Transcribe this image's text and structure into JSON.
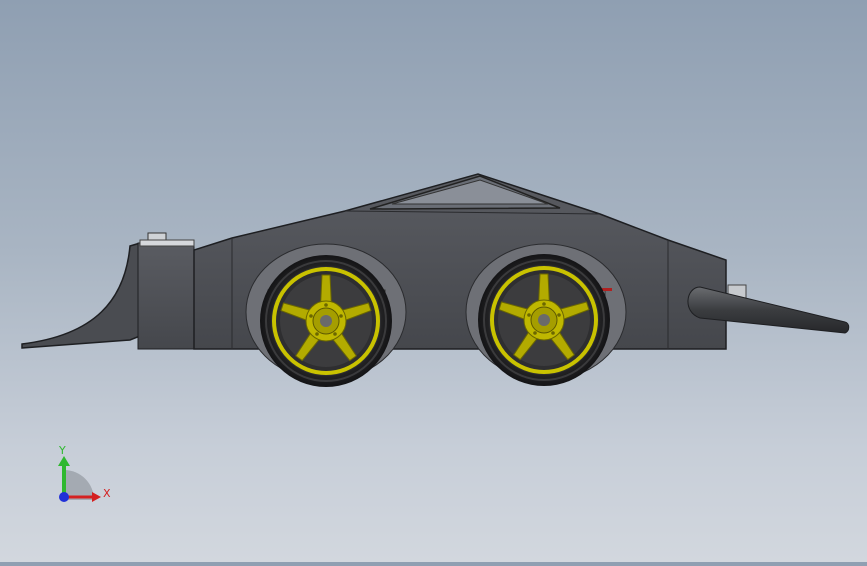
{
  "viewport": {
    "background_top": "#8f9fb2",
    "background_bottom": "#d2d7de"
  },
  "model": {
    "body_color": "#4d4f55",
    "wheel_color": "#b8b000",
    "tire_color": "#1c1c1e",
    "icons": [
      "robot-body",
      "plow-blade",
      "front-wheel",
      "rear-wheel",
      "nozzle"
    ]
  },
  "triad": {
    "y_label": "Y",
    "x_label": "X",
    "y_color": "#2fb82f",
    "x_color": "#d42020",
    "z_color": "#2030d8"
  }
}
